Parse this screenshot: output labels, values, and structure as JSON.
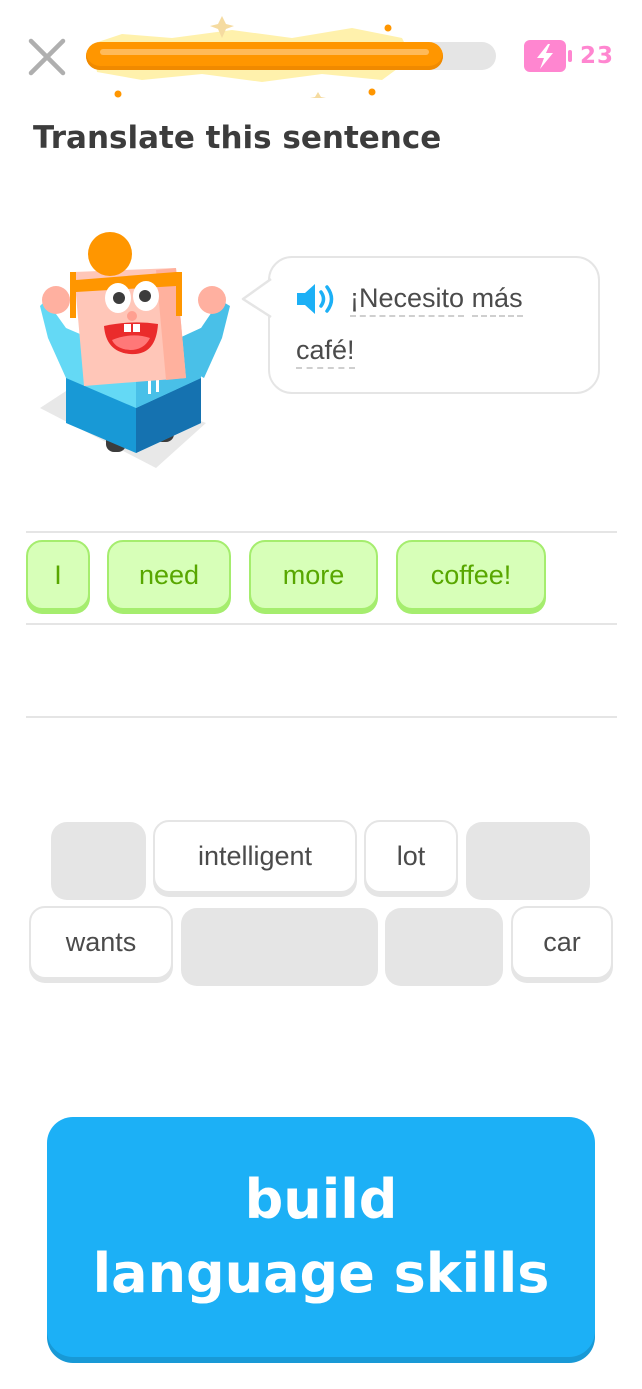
{
  "header": {
    "close_icon": "close-icon",
    "progress": 0.87,
    "progress_color": "#ff9600",
    "energy_icon": "energy-battery-icon",
    "energy_count": "23",
    "energy_color": "#ff86d0"
  },
  "prompt": {
    "title": "Translate this sentence"
  },
  "bubble": {
    "speaker_icon": "speaker-icon",
    "words": [
      "¡Necesito",
      "más",
      "café!"
    ]
  },
  "answer": {
    "chips": [
      "I",
      "need",
      "more",
      "coffee!"
    ]
  },
  "word_bank": {
    "row1": [
      "",
      "intelligent",
      "lot",
      ""
    ],
    "row2": [
      "wants",
      "",
      "",
      "car"
    ]
  },
  "cta": {
    "line1": "build",
    "line2": "language skills",
    "color": "#1cb0f6"
  }
}
